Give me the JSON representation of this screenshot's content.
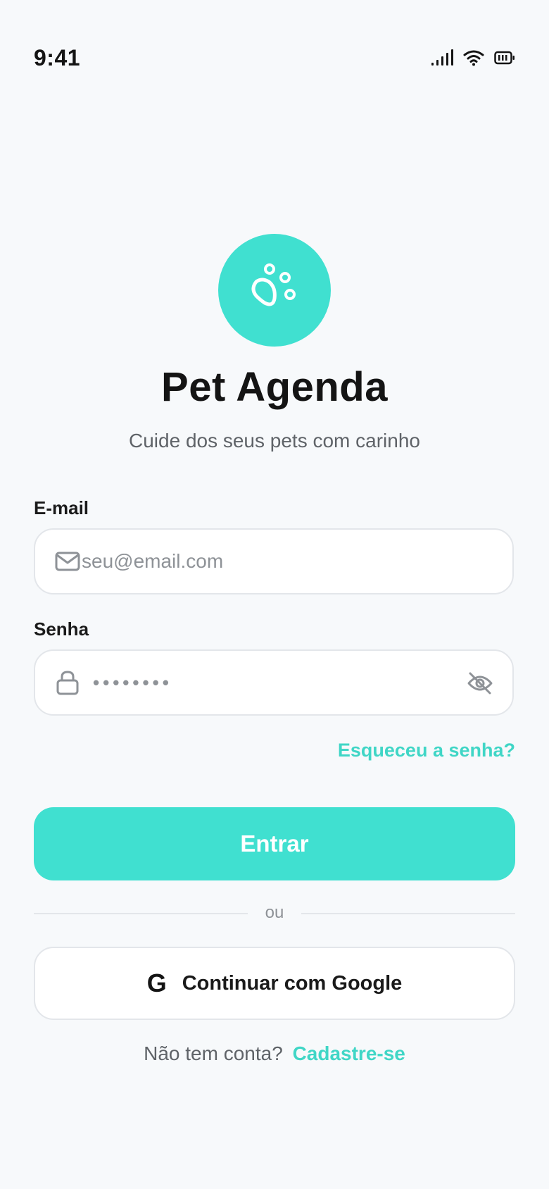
{
  "status_bar": {
    "time": "9:41",
    "icons": [
      "signal-icon",
      "wifi-icon",
      "battery-icon"
    ]
  },
  "logo": {
    "icon": "paw-icon",
    "color": "#40e0d0"
  },
  "app": {
    "title": "Pet Agenda",
    "subtitle": "Cuide dos seus pets com carinho"
  },
  "form": {
    "email": {
      "label": "E-mail",
      "placeholder": "seu@email.com",
      "value": "",
      "icon": "mail-icon"
    },
    "password": {
      "label": "Senha",
      "masked_value": "••••••••",
      "icon": "lock-icon",
      "toggle_icon": "eye-off-icon"
    },
    "forgot_link": "Esqueceu a senha?",
    "submit_label": "Entrar"
  },
  "divider": {
    "text": "ou"
  },
  "google": {
    "icon_glyph": "G",
    "label": "Continuar com Google"
  },
  "signup": {
    "question": "Não tem conta?",
    "link": "Cadastre-se"
  },
  "colors": {
    "accent": "#40e0d0",
    "background": "#f7f9fb",
    "muted_text": "#5f6368"
  }
}
